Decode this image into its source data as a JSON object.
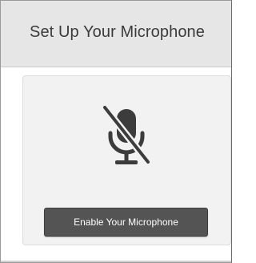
{
  "dialog": {
    "title": "Set Up Your Microphone",
    "icon": "microphone-muted-icon",
    "button_label": "Enable Your Microphone"
  },
  "colors": {
    "header_bg": "#e6e6e6",
    "card_bg": "#f2f2f2",
    "button_bg": "#545454",
    "icon": "#3c3c3c"
  }
}
